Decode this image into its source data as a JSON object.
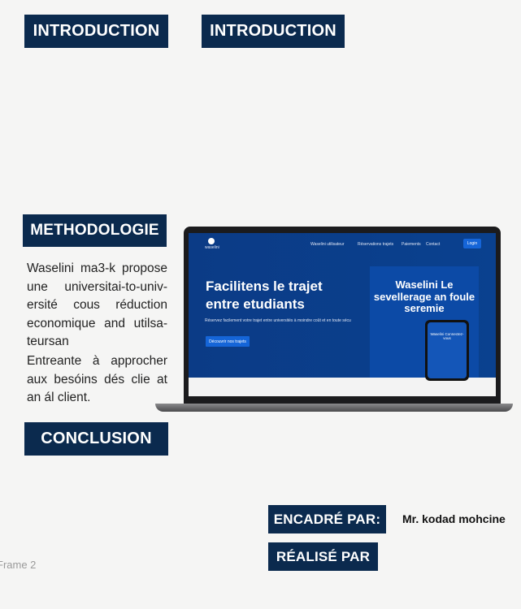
{
  "headers": {
    "intro1": "INTRODUCTION",
    "intro2": "INTRODUCTION",
    "method": "METHODOLOGIE",
    "conclusion": "CONCLUSION",
    "encadre": "ENCADRÉ PAR:",
    "realise": "RÉALISÉ PAR"
  },
  "methodologie": {
    "p1": "Waselini ma3-k propose une universitai-to-univ-ersité cous réduction economique and utilsa-teursan",
    "p2": "Entreante à approcher aux besóins dés clie at an ál client."
  },
  "supervisor": "Mr. kodad mohcine",
  "frame_label": "Frame 2",
  "website": {
    "logo": "waselini",
    "nav": [
      "Waselini utilisateur",
      "Réservations trajets",
      "Paiements",
      "Contact"
    ],
    "nav_button": "Login",
    "hero_title": "Facilitens le trajet entre etudiants",
    "hero_sub": "Réservez facilement votre trajet entre universités à moindre coût et en toute sécurité",
    "hero_button": "Découvrir nos trajets",
    "promo_title": "Waselini Le sevellerage an foule seremie",
    "phone_text": "Waselini Connectez-vous"
  },
  "colors": {
    "navy": "#0b2a4e",
    "site_blue": "#0b3b86",
    "button_blue": "#1565d8"
  }
}
